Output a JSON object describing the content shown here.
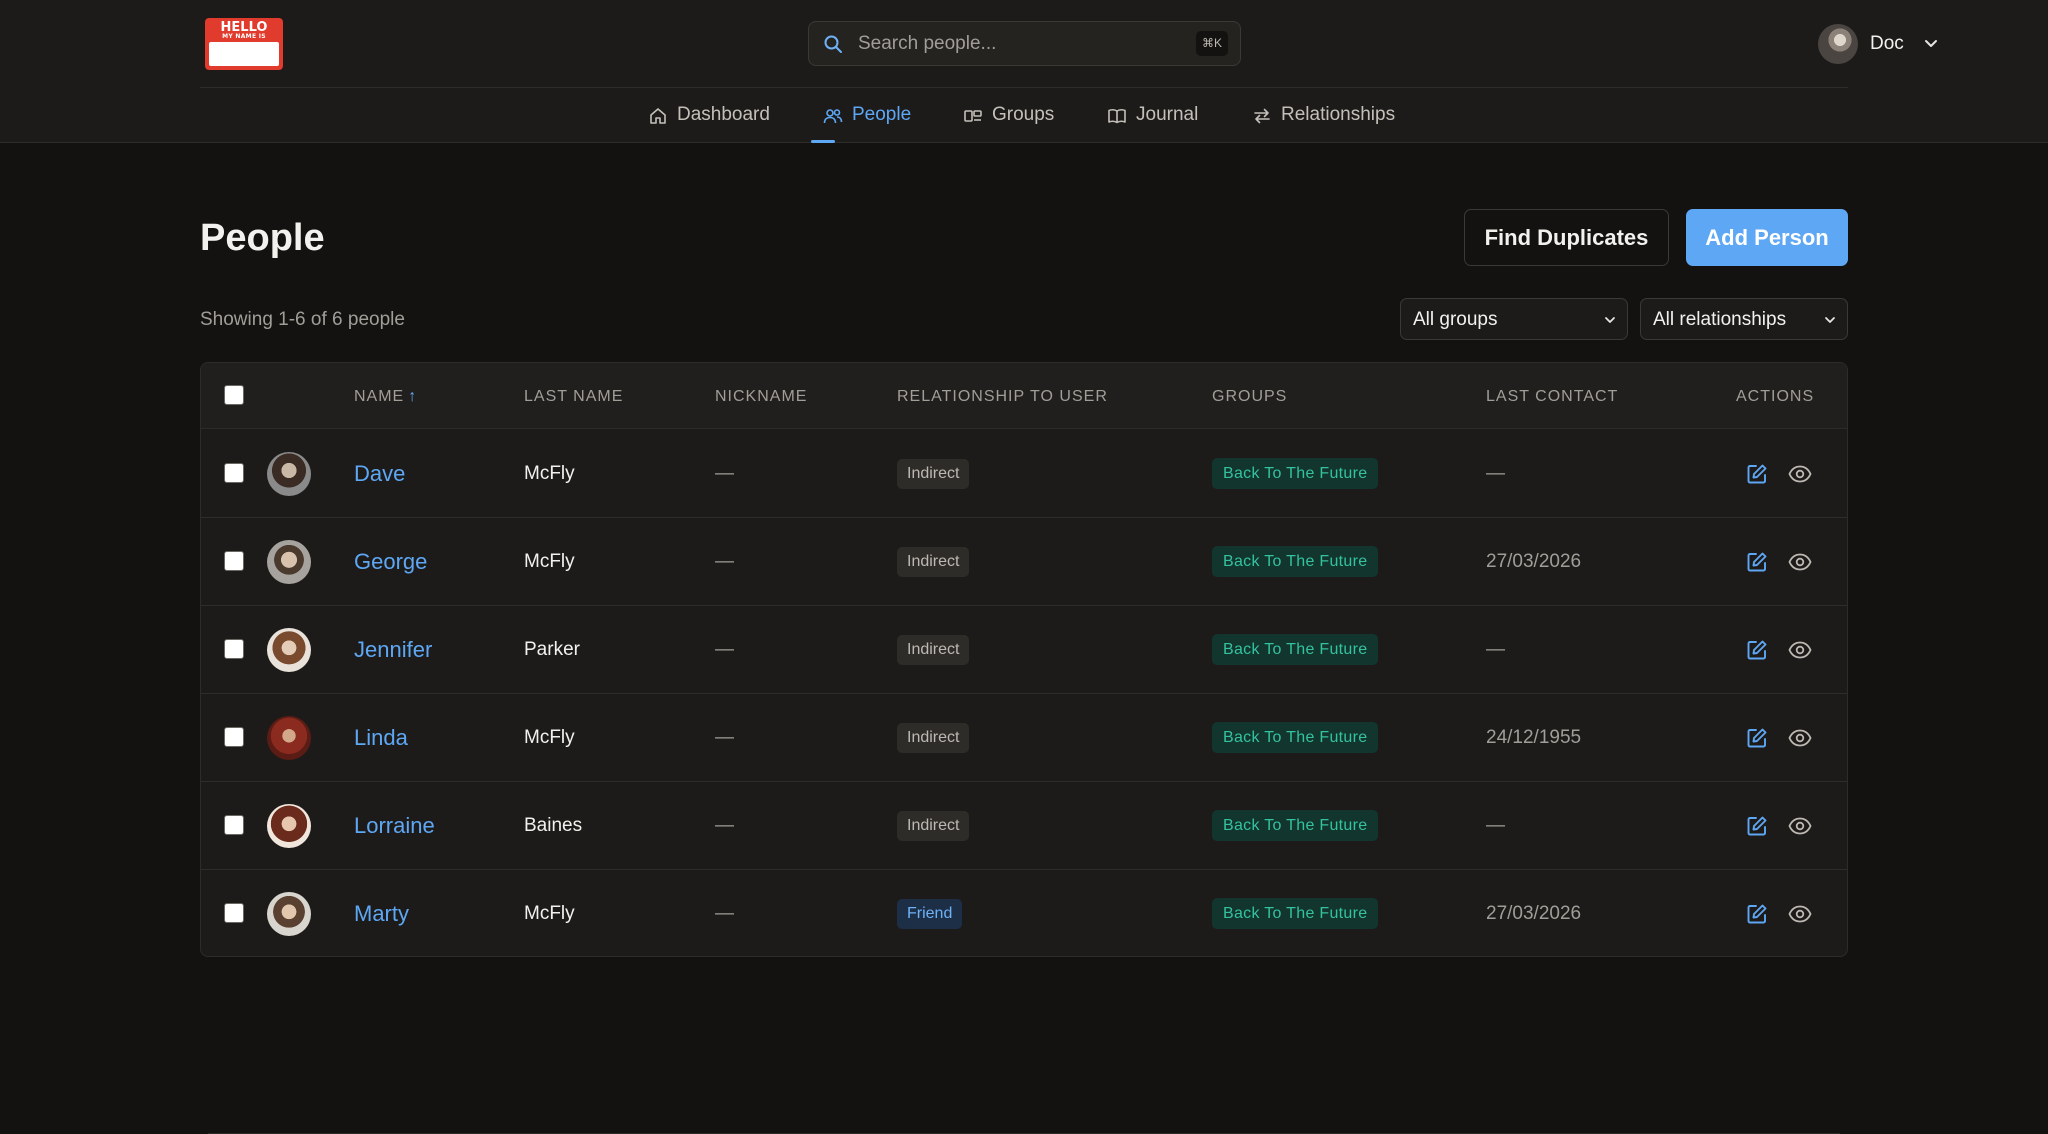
{
  "header": {
    "logo": {
      "line1": "HELLO",
      "line2": "MY NAME IS"
    },
    "search": {
      "placeholder": "Search people...",
      "shortcut": "⌘K"
    },
    "user": {
      "name": "Doc"
    }
  },
  "nav": {
    "tabs": [
      {
        "label": "Dashboard",
        "icon": "home-icon",
        "active": false
      },
      {
        "label": "People",
        "icon": "users-icon",
        "active": true
      },
      {
        "label": "Groups",
        "icon": "groups-icon",
        "active": false
      },
      {
        "label": "Journal",
        "icon": "book-icon",
        "active": false
      },
      {
        "label": "Relationships",
        "icon": "arrows-swap-icon",
        "active": false
      }
    ]
  },
  "page": {
    "title": "People",
    "find_duplicates_label": "Find Duplicates",
    "add_person_label": "Add Person",
    "showing": "Showing 1-6 of 6 people",
    "filters": {
      "groups": "All groups",
      "relationships": "All relationships"
    }
  },
  "table": {
    "columns": [
      "NAME",
      "LAST NAME",
      "NICKNAME",
      "RELATIONSHIP TO USER",
      "GROUPS",
      "LAST CONTACT",
      "ACTIONS"
    ],
    "sort_indicator": "↑",
    "rows": [
      {
        "name": "Dave",
        "last_name": "McFly",
        "nickname": "—",
        "relationship": "Indirect",
        "group": "Back To The Future",
        "last_contact": "—"
      },
      {
        "name": "George",
        "last_name": "McFly",
        "nickname": "—",
        "relationship": "Indirect",
        "group": "Back To The Future",
        "last_contact": "27/03/2026"
      },
      {
        "name": "Jennifer",
        "last_name": "Parker",
        "nickname": "—",
        "relationship": "Indirect",
        "group": "Back To The Future",
        "last_contact": "—"
      },
      {
        "name": "Linda",
        "last_name": "McFly",
        "nickname": "—",
        "relationship": "Indirect",
        "group": "Back To The Future",
        "last_contact": "24/12/1955"
      },
      {
        "name": "Lorraine",
        "last_name": "Baines",
        "nickname": "—",
        "relationship": "Indirect",
        "group": "Back To The Future",
        "last_contact": "—"
      },
      {
        "name": "Marty",
        "last_name": "McFly",
        "nickname": "—",
        "relationship": "Friend",
        "group": "Back To The Future",
        "last_contact": "27/03/2026"
      }
    ]
  },
  "colors": {
    "accent": "#5ea7f4",
    "background": "#131211",
    "surface": "#1c1b19",
    "group_badge_text": "#34c29f",
    "group_badge_bg": "#12352e"
  }
}
